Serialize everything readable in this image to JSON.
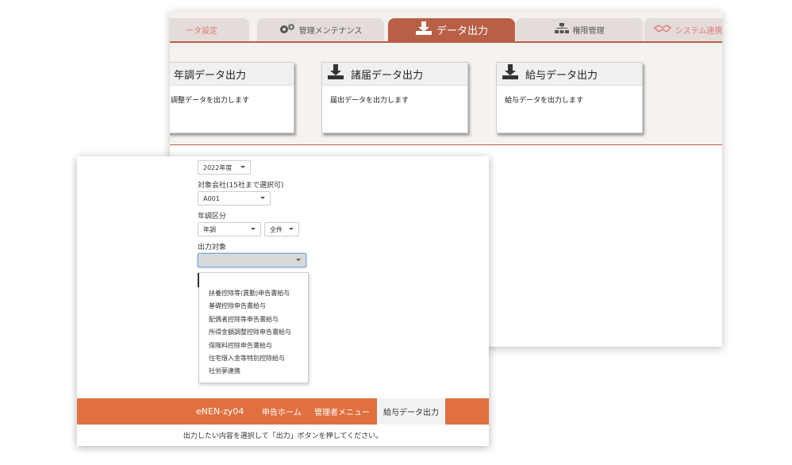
{
  "back_window": {
    "tabs": [
      {
        "label": "ータ設定"
      },
      {
        "label": "管理メンテナンス"
      },
      {
        "label": "データ出力"
      },
      {
        "label": "権限管理"
      },
      {
        "label": "システム連携"
      }
    ],
    "cards": [
      {
        "title": "年調データ出力",
        "desc": "調整データを出力します"
      },
      {
        "title": "諸届データ出力",
        "desc": "届出データを出力します"
      },
      {
        "title": "給与データ出力",
        "desc": "給与データを出力します"
      }
    ]
  },
  "form": {
    "year_value": "2022年度",
    "company_label": "対象会社(15社まで選択可)",
    "company_value": "A001",
    "nencho_label": "年調区分",
    "nencho_value": "年調",
    "scope_value": "全件",
    "target_label": "出力対象",
    "target_value": "",
    "options": [
      "扶養控除等(異動)申告書給与",
      "基礎控除申告書給与",
      "配偶者控除等申告書給与",
      "所得金額調整控除申告書給与",
      "保険料控除申告書給与",
      "住宅借入金等特別控除給与",
      "社労夢連携"
    ]
  },
  "footer": {
    "brand": "eNEN-zy04",
    "links": [
      "申告ホーム",
      "管理者メニュー",
      "給与データ出力"
    ]
  },
  "status_text": "出力したい内容を選択して「出力」ボタンを押してください。",
  "colors": {
    "tab_active": "#b85f45",
    "footer": "#e07040"
  },
  "icons": [
    "gear-icon",
    "download-icon",
    "org-chart-icon",
    "handshake-icon"
  ]
}
